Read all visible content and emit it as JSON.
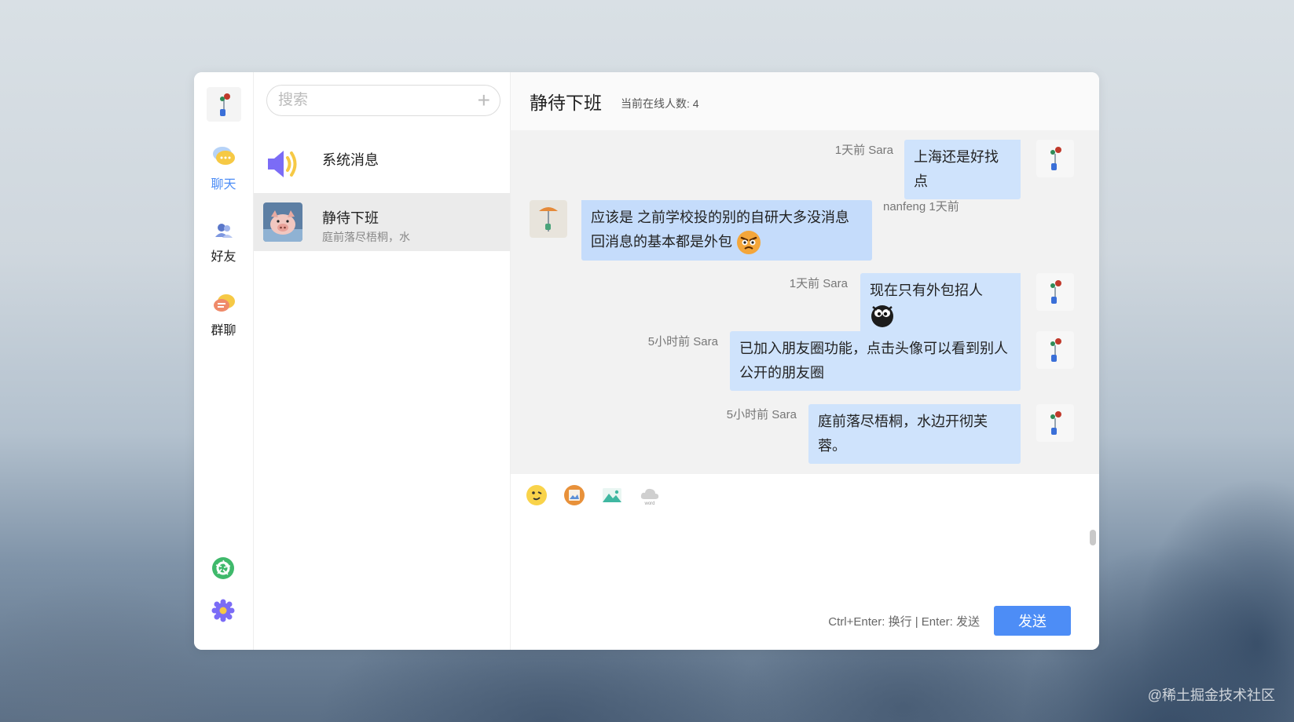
{
  "watermark": "@稀土掘金技术社区",
  "nav": {
    "items": [
      {
        "label": "聊天",
        "icon": "chat-bubbles-icon",
        "active": true
      },
      {
        "label": "好友",
        "icon": "friends-icon",
        "active": false
      },
      {
        "label": "群聊",
        "icon": "group-chat-icon",
        "active": false
      }
    ],
    "bottom": [
      {
        "icon": "moments-aperture-icon"
      },
      {
        "icon": "settings-gear-icon"
      }
    ]
  },
  "search": {
    "placeholder": "搜索",
    "add_label": "+"
  },
  "conversations": [
    {
      "title": "系统消息",
      "subtitle": "",
      "icon": "speaker-icon"
    },
    {
      "title": "静待下班",
      "subtitle": "庭前落尽梧桐，水",
      "icon": "pig-avatar",
      "active": true
    }
  ],
  "chat": {
    "title": "静待下班",
    "online_label": "当前在线人数: 4",
    "messages": [
      {
        "side": "me",
        "meta": "1天前 Sara",
        "text": "上海还是好找点"
      },
      {
        "side": "other",
        "meta": "nanfeng 1天前",
        "text": "应该是 之前学校投的别的自研大多没消息 回消息的基本都是外包",
        "emoji": "angry-face-emoji"
      },
      {
        "side": "me",
        "meta": "1天前 Sara",
        "text": "现在只有外包招人",
        "emoji": "big-eyes-emoji"
      },
      {
        "side": "me",
        "meta": "5小时前 Sara",
        "text": "已加入朋友圈功能，点击头像可以看到别人公开的朋友圈"
      },
      {
        "side": "me",
        "meta": "5小时前 Sara",
        "text": "庭前落尽梧桐，水边开彻芙蓉。"
      }
    ],
    "toolbar": [
      {
        "icon": "emoji-face-icon"
      },
      {
        "icon": "image-frame-icon"
      },
      {
        "icon": "landscape-image-icon"
      },
      {
        "icon": "word-cloud-icon",
        "caption": "word"
      }
    ],
    "hint": "Ctrl+Enter: 换行 | Enter: 发送",
    "send_label": "发送"
  },
  "colors": {
    "accent": "#4d8df6",
    "bubble_me": "#cfe3fc",
    "bubble_other": "#c5dcfb"
  }
}
